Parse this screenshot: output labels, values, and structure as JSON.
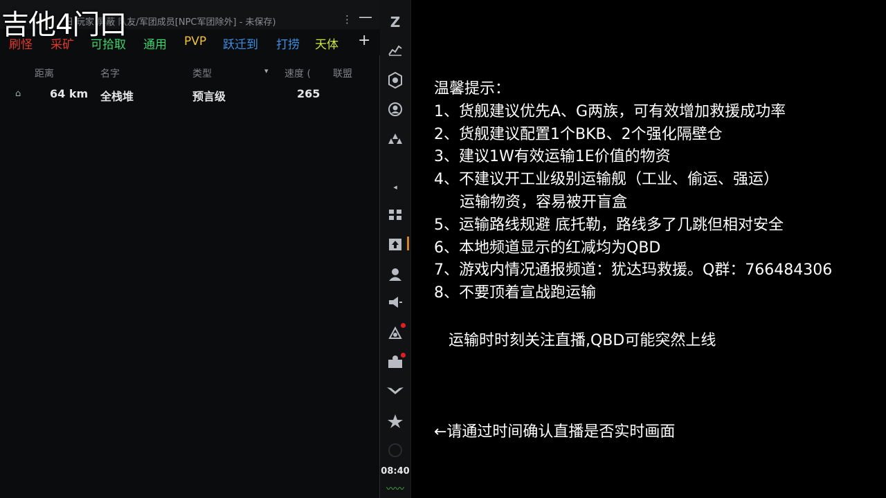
{
  "overlay": {
    "streamer_text": "吉他4门口"
  },
  "overview": {
    "title": "日  玩家  屏蔽  队友/军团成员[NPC军团除外] - 未保存)",
    "menu_icon": "⋮",
    "minimize_icon": "—",
    "tabs": [
      {
        "label": "刷怪",
        "color": "#e0392b"
      },
      {
        "label": "采矿",
        "color": "#e0392b"
      },
      {
        "label": "可拾取",
        "color": "#39d46a"
      },
      {
        "label": "通用",
        "color": "#39d46a"
      },
      {
        "label": "PVP",
        "color": "#f2c238"
      },
      {
        "label": "跃迁到",
        "color": "#3d8fe8"
      },
      {
        "label": "打捞",
        "color": "#3d8fe8"
      },
      {
        "label": "天体",
        "color": "#c8e63a"
      }
    ],
    "add_tab": "+",
    "columns": {
      "distance": "距离",
      "name": "名字",
      "type": "类型",
      "speed": "速度 (",
      "alliance": "联盟"
    },
    "sort_arrow": "▾",
    "rows": [
      {
        "icon": "⌂",
        "distance": "64 km",
        "name": "全栈堆",
        "type": "预言级",
        "speed": "265"
      }
    ]
  },
  "neocom": {
    "icons": [
      "zeta-logo-icon",
      "market-chart-icon",
      "fitting-icon",
      "character-icon",
      "fleet-icon",
      "collapse-arrow-icon",
      "inventory-icon",
      "hangar-icon",
      "contacts-icon",
      "broadcast-icon",
      "mail-icon",
      "corporation-icon",
      "wings-icon",
      "alliance-icon",
      "blank-icon"
    ],
    "clock": "08:40",
    "signal": "〰〰"
  },
  "notice": {
    "heading": "温馨提示：",
    "lines": [
      "1、货舰建议优先A、G两族，可有效增加救援成功率",
      "2、货舰建议配置1个BKB、2个强化隔壁仓",
      "3、建议1W有效运输1E价值的物资",
      "4、不建议开工业级别运输舰（工业、偷运、强运）",
      "运输物资，容易被开盲盒",
      "5、运输路线规避 底托勒，路线多了几跳但相对安全",
      "6、本地频道显示的红减均为QBD",
      "7、游戏内情况通报频道：犹达玛救援。Q群：766484306",
      "8、不要顶着宣战跑运输"
    ],
    "live_warning": "运输时时刻关注直播,QBD可能突然上线",
    "time_confirm": "←请通过时间确认直播是否实时画面"
  }
}
